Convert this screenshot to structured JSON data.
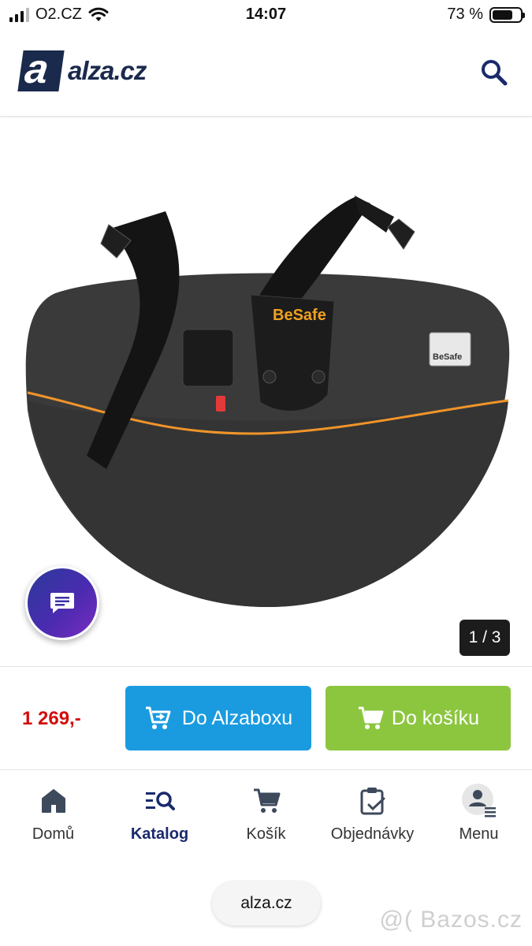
{
  "status_bar": {
    "carrier": "O2.CZ",
    "time": "14:07",
    "battery": "73 %",
    "battery_level": 0.73
  },
  "header": {
    "logo_mark": "a",
    "logo_text": "alza.cz",
    "search_icon": "search-icon"
  },
  "gallery": {
    "brand_label": "BeSafe",
    "counter": "1 / 3",
    "chat_icon": "chat-icon"
  },
  "buy": {
    "price": "1 269,-",
    "alzabox_label": "Do Alzaboxu",
    "cart_label": "Do košíku",
    "colors": {
      "alzabox": "#1a9be0",
      "cart": "#8cc63f",
      "price": "#d30d0d"
    }
  },
  "nav": {
    "items": [
      {
        "label": "Domů",
        "icon": "home-icon"
      },
      {
        "label": "Katalog",
        "icon": "catalog-search-icon",
        "active": true
      },
      {
        "label": "Košík",
        "icon": "cart-icon"
      },
      {
        "label": "Objednávky",
        "icon": "orders-clipboard-icon"
      },
      {
        "label": "Menu",
        "icon": "user-menu-icon"
      }
    ]
  },
  "browser": {
    "url": "alza.cz"
  },
  "watermark": "@( Bazos.cz"
}
